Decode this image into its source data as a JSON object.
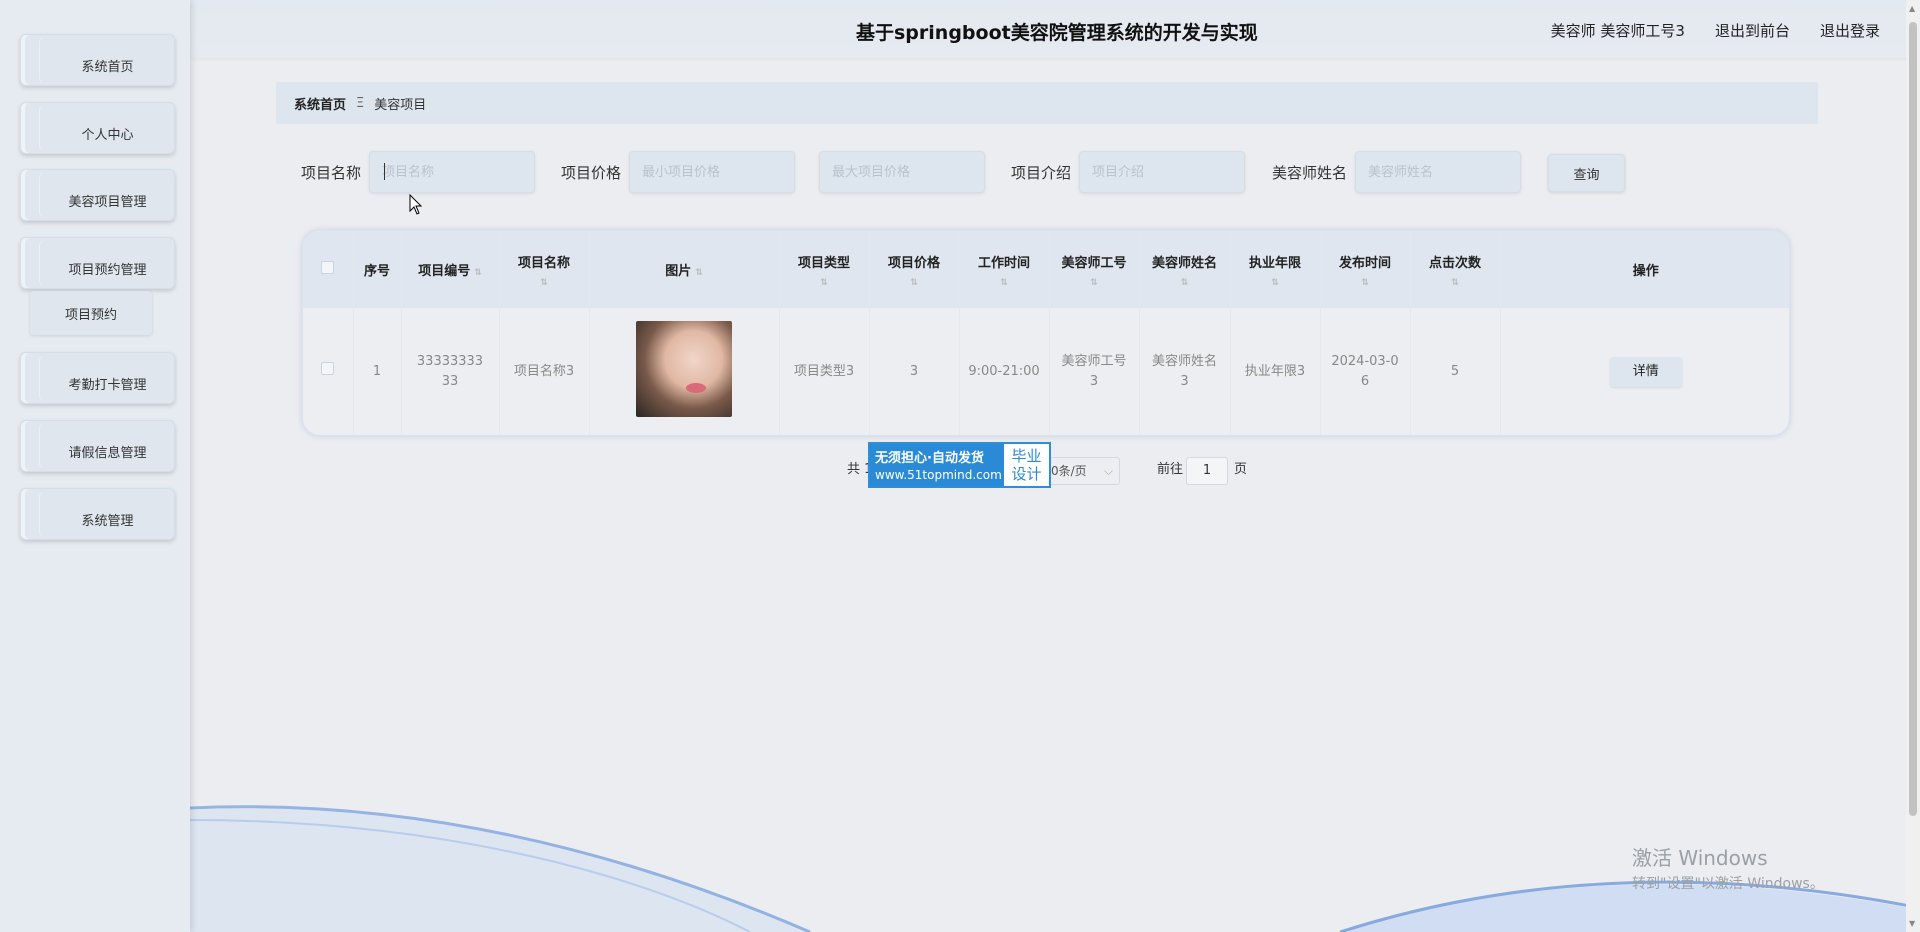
{
  "sidebar": {
    "items": [
      {
        "label": "系统首页"
      },
      {
        "label": "个人中心"
      },
      {
        "label": "美容项目管理"
      },
      {
        "label": "项目预约管理"
      },
      {
        "label": "考勤打卡管理"
      },
      {
        "label": "请假信息管理"
      },
      {
        "label": "系统管理"
      }
    ],
    "sub_items": [
      {
        "label": "项目预约"
      }
    ]
  },
  "header": {
    "title": "基于springboot美容院管理系统的开发与实现",
    "user": "美容师 美容师工号3",
    "to_front": "退出到前台",
    "logout": "退出登录"
  },
  "breadcrumb": {
    "home": "系统首页",
    "separator": "Ξ",
    "current": "美容项目"
  },
  "search": {
    "name_label": "项目名称",
    "name_placeholder": "项目名称",
    "price_label": "项目价格",
    "min_price_placeholder": "最小项目价格",
    "max_price_placeholder": "最大项目价格",
    "intro_label": "项目介绍",
    "intro_placeholder": "项目介绍",
    "beautician_label": "美容师姓名",
    "beautician_placeholder": "美容师姓名",
    "query_button": "查询"
  },
  "table": {
    "headers": [
      "序号",
      "项目编号",
      "项目名称",
      "图片",
      "项目类型",
      "项目价格",
      "工作时间",
      "美容师工号",
      "美容师姓名",
      "执业年限",
      "发布时间",
      "点击次数",
      "操作"
    ],
    "rows": [
      {
        "index": "1",
        "code": "3333333333",
        "name": "项目名称3",
        "type": "项目类型3",
        "price": "3",
        "work_time": "9:00-21:00",
        "beautician_id": "美容师工号3",
        "beautician_name": "美容师姓名3",
        "years": "执业年限3",
        "published": "2024-03-06",
        "clicks": "5",
        "action": "详情"
      }
    ]
  },
  "pagination": {
    "total_prefix": "共 1",
    "page_size": "0条/页",
    "goto_label": "前往",
    "goto_value": "1",
    "page_suffix": "页"
  },
  "badge": {
    "line1": "无须担心·自动发货",
    "line2": "www.51topmind.com",
    "right_line1": "毕业",
    "right_line2": "设计"
  },
  "activation": {
    "title": "激活 Windows",
    "subtitle": "转到\"设置\"以激活 Windows。"
  },
  "colors": {
    "accent": "#2b8ad6",
    "panel": "#dde5ee",
    "background": "#ecedf0"
  }
}
